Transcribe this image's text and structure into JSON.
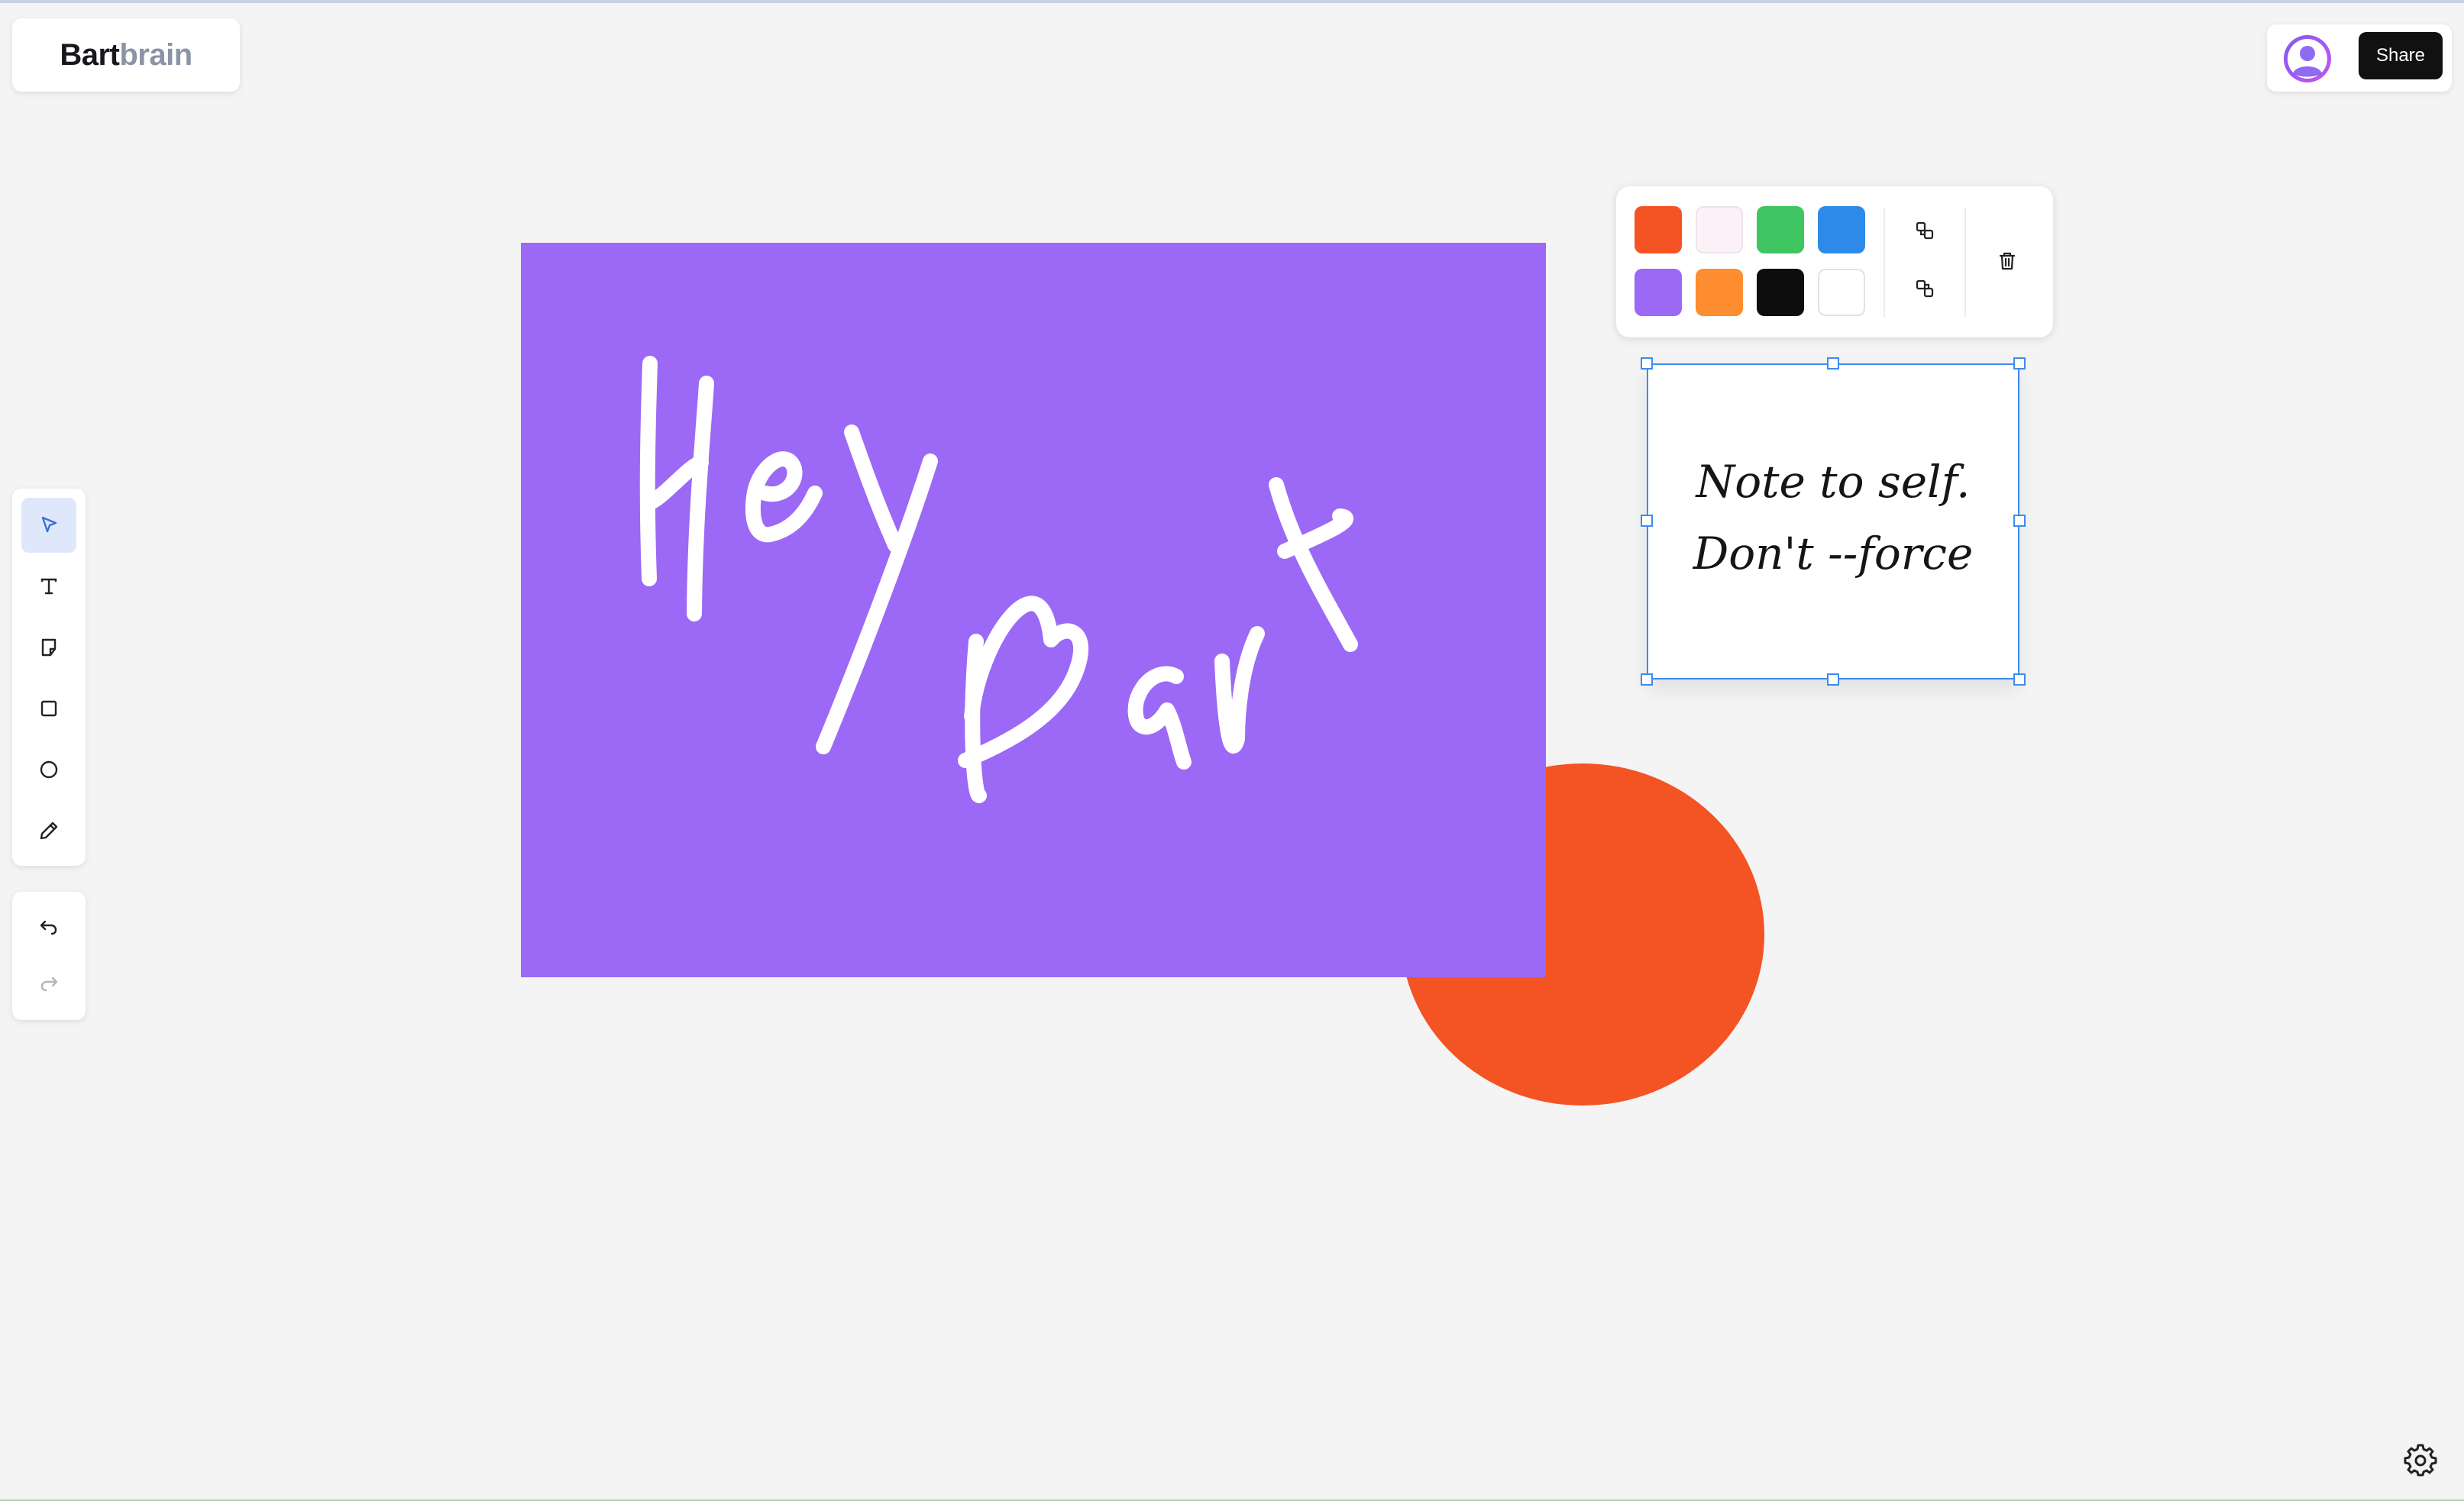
{
  "logo": {
    "part1": "Bart",
    "part2": "brain"
  },
  "header": {
    "share_label": "Share"
  },
  "toolbar": {
    "tools": [
      {
        "icon": "select-arrow-icon",
        "active": true
      },
      {
        "icon": "text-icon"
      },
      {
        "icon": "sticky-note-icon"
      },
      {
        "icon": "rectangle-icon"
      },
      {
        "icon": "ellipse-icon"
      },
      {
        "icon": "pencil-icon"
      }
    ],
    "history": [
      {
        "icon": "undo-icon"
      },
      {
        "icon": "redo-icon",
        "disabled": true
      }
    ]
  },
  "colors": {
    "palette": [
      "#f45324",
      "#fdf1f8",
      "#3fc562",
      "#2d8ae8",
      "#9b69f5",
      "#fd8d2f",
      "#0d0d0d",
      "#ffffff"
    ],
    "accent": "#3d8bef",
    "canvas_bg": "#f4f4f4"
  },
  "canvas": {
    "rectangle_color": "#9b69f5",
    "ellipse_color": "#f45324",
    "drawing_color": "#ffffff"
  },
  "popover": {
    "actions": [
      {
        "icon": "bring-forward-icon"
      },
      {
        "icon": "send-backward-icon"
      },
      {
        "icon": "trash-icon"
      }
    ]
  },
  "note": {
    "line1": "Note to self.",
    "line2": "Don't --force"
  },
  "footer": {
    "settings_icon": "gear-icon"
  }
}
